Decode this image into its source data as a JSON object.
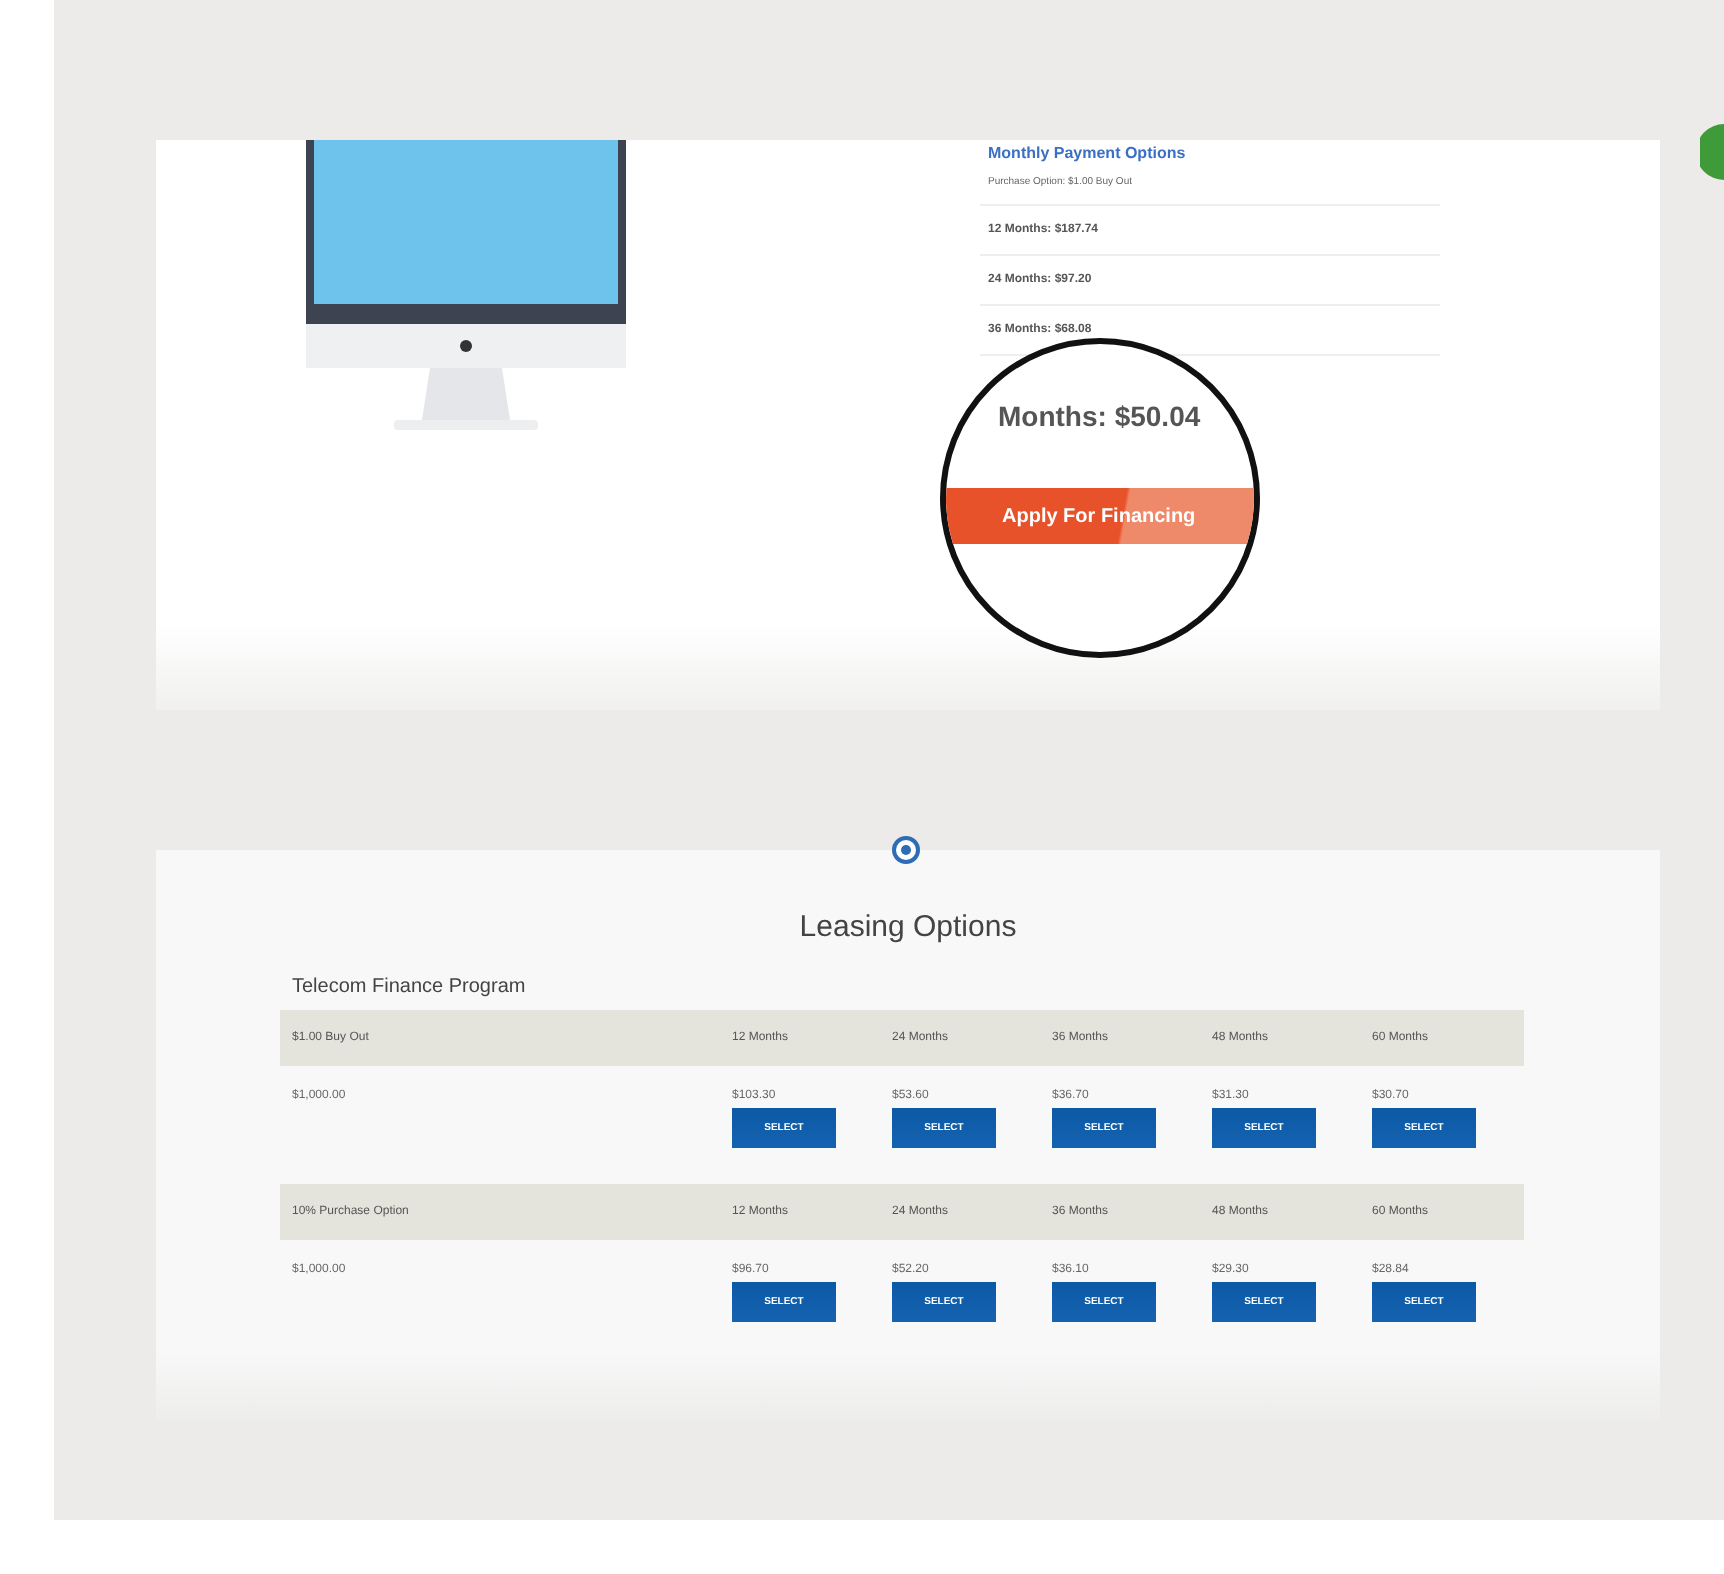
{
  "product_panel": {
    "heading": "Monthly Payment Options",
    "purchase_option": "Purchase Option: $1.00 Buy Out",
    "terms": [
      "12 Months: $187.74",
      "24 Months: $97.20",
      "36 Months: $68.08"
    ],
    "magnified": {
      "term": "Months: $50.04",
      "button": "Apply For Financing"
    }
  },
  "leasing": {
    "title": "Leasing Options",
    "program": "Telecom Finance Program",
    "tables": [
      {
        "option": "$1.00 Buy Out",
        "columns": [
          "12 Months",
          "24 Months",
          "36 Months",
          "48 Months",
          "60 Months"
        ],
        "amount": "$1,000.00",
        "prices": [
          {
            "price": "$103.30",
            "button": "SELECT"
          },
          {
            "price": "$53.60",
            "button": "SELECT"
          },
          {
            "price": "$36.70",
            "button": "SELECT"
          },
          {
            "price": "$31.30",
            "button": "SELECT"
          },
          {
            "price": "$30.70",
            "button": "SELECT"
          }
        ]
      },
      {
        "option": "10% Purchase Option",
        "columns": [
          "12 Months",
          "24 Months",
          "36 Months",
          "48 Months",
          "60 Months"
        ],
        "amount": "$1,000.00",
        "prices": [
          {
            "price": "$96.70",
            "button": "SELECT"
          },
          {
            "price": "$52.20",
            "button": "SELECT"
          },
          {
            "price": "$36.10",
            "button": "SELECT"
          },
          {
            "price": "$29.30",
            "button": "SELECT"
          },
          {
            "price": "$28.84",
            "button": "SELECT"
          }
        ]
      }
    ]
  }
}
